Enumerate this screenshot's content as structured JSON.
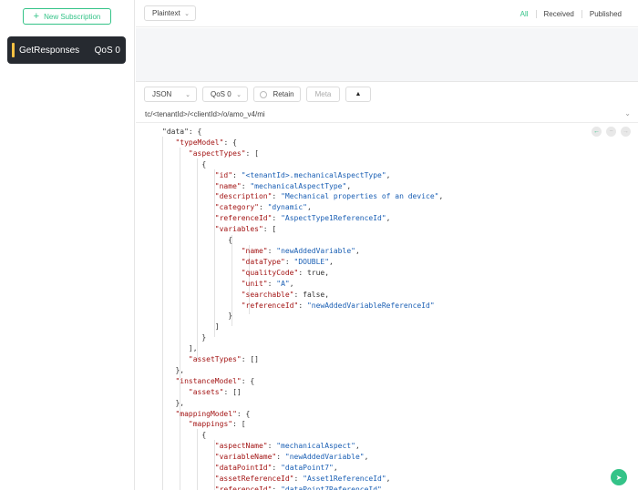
{
  "sidebar": {
    "new_subscription_label": "New Subscription",
    "subscriptions": [
      {
        "name": "GetResponses",
        "qos": "QoS 0"
      }
    ]
  },
  "header": {
    "payload_format": "Plaintext",
    "filters": [
      "All",
      "Received",
      "Published"
    ],
    "active_filter": "All"
  },
  "publish": {
    "format": "JSON",
    "qos": "QoS 0",
    "retain_label": "Retain",
    "meta_label": "Meta",
    "topic": "tc/<tenantId>/<clientId>/o/amo_v4/mi"
  },
  "editor": {
    "lines": [
      [
        [
          0,
          "p",
          "\"data\": {"
        ]
      ],
      [
        [
          1,
          "k",
          "\"typeModel\""
        ],
        [
          1,
          "p",
          ": {"
        ]
      ],
      [
        [
          2,
          "k",
          "\"aspectTypes\""
        ],
        [
          2,
          "p",
          ": ["
        ]
      ],
      [
        [
          3,
          "p",
          "{"
        ]
      ],
      [
        [
          4,
          "k",
          "\"id\""
        ],
        [
          4,
          "p",
          ": "
        ],
        [
          4,
          "s",
          "\"<tenantId>.mechanicalAspectType\""
        ],
        [
          4,
          "p",
          ","
        ]
      ],
      [
        [
          4,
          "k",
          "\"name\""
        ],
        [
          4,
          "p",
          ": "
        ],
        [
          4,
          "s",
          "\"mechanicalAspectType\""
        ],
        [
          4,
          "p",
          ","
        ]
      ],
      [
        [
          4,
          "k",
          "\"description\""
        ],
        [
          4,
          "p",
          ": "
        ],
        [
          4,
          "s",
          "\"Mechanical properties of an device\""
        ],
        [
          4,
          "p",
          ","
        ]
      ],
      [
        [
          4,
          "k",
          "\"category\""
        ],
        [
          4,
          "p",
          ": "
        ],
        [
          4,
          "s",
          "\"dynamic\""
        ],
        [
          4,
          "p",
          ","
        ]
      ],
      [
        [
          4,
          "k",
          "\"referenceId\""
        ],
        [
          4,
          "p",
          ": "
        ],
        [
          4,
          "s",
          "\"AspectType1ReferenceId\""
        ],
        [
          4,
          "p",
          ","
        ]
      ],
      [
        [
          4,
          "k",
          "\"variables\""
        ],
        [
          4,
          "p",
          ": ["
        ]
      ],
      [
        [
          5,
          "p",
          "{"
        ]
      ],
      [
        [
          6,
          "k",
          "\"name\""
        ],
        [
          6,
          "p",
          ": "
        ],
        [
          6,
          "s",
          "\"newAddedVariable\""
        ],
        [
          6,
          "p",
          ","
        ]
      ],
      [
        [
          6,
          "k",
          "\"dataType\""
        ],
        [
          6,
          "p",
          ": "
        ],
        [
          6,
          "s",
          "\"DOUBLE\""
        ],
        [
          6,
          "p",
          ","
        ]
      ],
      [
        [
          6,
          "k",
          "\"qualityCode\""
        ],
        [
          6,
          "p",
          ": true,"
        ]
      ],
      [
        [
          6,
          "k",
          "\"unit\""
        ],
        [
          6,
          "p",
          ": "
        ],
        [
          6,
          "s",
          "\"A\""
        ],
        [
          6,
          "p",
          ","
        ]
      ],
      [
        [
          6,
          "k",
          "\"searchable\""
        ],
        [
          6,
          "p",
          ": false,"
        ]
      ],
      [
        [
          6,
          "k",
          "\"referenceId\""
        ],
        [
          6,
          "p",
          ": "
        ],
        [
          6,
          "s",
          "\"newAddedVariableReferenceId\""
        ]
      ],
      [
        [
          5,
          "p",
          "}"
        ]
      ],
      [
        [
          4,
          "p",
          "]"
        ]
      ],
      [
        [
          3,
          "p",
          "}"
        ]
      ],
      [
        [
          2,
          "p",
          "],"
        ]
      ],
      [
        [
          2,
          "k",
          "\"assetTypes\""
        ],
        [
          2,
          "p",
          ": []"
        ]
      ],
      [
        [
          1,
          "p",
          "},"
        ]
      ],
      [
        [
          1,
          "k",
          "\"instanceModel\""
        ],
        [
          1,
          "p",
          ": {"
        ]
      ],
      [
        [
          2,
          "k",
          "\"assets\""
        ],
        [
          2,
          "p",
          ": []"
        ]
      ],
      [
        [
          1,
          "p",
          "},"
        ]
      ],
      [
        [
          1,
          "k",
          "\"mappingModel\""
        ],
        [
          1,
          "p",
          ": {"
        ]
      ],
      [
        [
          2,
          "k",
          "\"mappings\""
        ],
        [
          2,
          "p",
          ": ["
        ]
      ],
      [
        [
          3,
          "p",
          "{"
        ]
      ],
      [
        [
          4,
          "k",
          "\"aspectName\""
        ],
        [
          4,
          "p",
          ": "
        ],
        [
          4,
          "s",
          "\"mechanicalAspect\""
        ],
        [
          4,
          "p",
          ","
        ]
      ],
      [
        [
          4,
          "k",
          "\"variableName\""
        ],
        [
          4,
          "p",
          ": "
        ],
        [
          4,
          "s",
          "\"newAddedVariable\""
        ],
        [
          4,
          "p",
          ","
        ]
      ],
      [
        [
          4,
          "k",
          "\"dataPointId\""
        ],
        [
          4,
          "p",
          ": "
        ],
        [
          4,
          "s",
          "\"dataPoint7\""
        ],
        [
          4,
          "p",
          ","
        ]
      ],
      [
        [
          4,
          "k",
          "\"assetReferenceId\""
        ],
        [
          4,
          "p",
          ": "
        ],
        [
          4,
          "s",
          "\"Asset1ReferenceId\""
        ],
        [
          4,
          "p",
          ","
        ]
      ],
      [
        [
          4,
          "k",
          "\"referenceId\""
        ],
        [
          4,
          "p",
          ": "
        ],
        [
          4,
          "s",
          "\"dataPoint7ReferenceId\""
        ]
      ]
    ]
  },
  "icons": {
    "new_subscription": "plus-icon",
    "dropdown": "chevron-down-icon",
    "collapse": "caret-up-icon",
    "nav_prev": "arrow-left-icon",
    "nav_next": "arrow-right-icon",
    "send": "send-icon"
  },
  "colors": {
    "accent": "#34c388",
    "subscription_marker": "#f6c143",
    "subscription_bg": "#262a30"
  }
}
